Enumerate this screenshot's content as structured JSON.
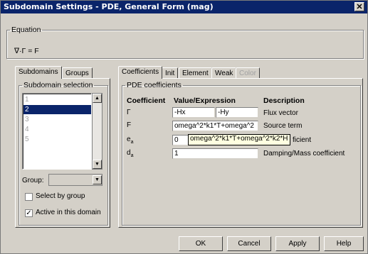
{
  "window": {
    "title": "Subdomain Settings - PDE, General Form (mag)",
    "close": "✕"
  },
  "equation": {
    "legend": "Equation",
    "text": "∇·Γ = F"
  },
  "left_tabs": [
    "Subdomains",
    "Groups"
  ],
  "subdomain_selection": {
    "legend": "Subdomain selection",
    "items": [
      "1",
      "2",
      "3",
      "4",
      "5"
    ],
    "selected_index": 1
  },
  "group": {
    "label": "Group:",
    "value": ""
  },
  "select_by_group": {
    "label": "Select by group",
    "checked": false
  },
  "active_in_domain": {
    "label": "Active in this domain",
    "checked": true
  },
  "right_tabs": [
    "Coefficients",
    "Init",
    "Element",
    "Weak",
    "Color"
  ],
  "pde": {
    "legend": "PDE coefficients",
    "headers": {
      "coefficient": "Coefficient",
      "value": "Value/Expression",
      "description": "Description"
    },
    "rows": [
      {
        "coef": "Γ",
        "value1": "-Hx",
        "value2": "-Hy",
        "desc": "Flux vector"
      },
      {
        "coef": "F",
        "value1": "omega^2*k1*T+omega^2",
        "desc": "Source term"
      },
      {
        "coef": "e",
        "sub": "a",
        "value1": "0",
        "desc": "ficient"
      },
      {
        "coef": "d",
        "sub": "a",
        "value1": "1",
        "desc": "Damping/Mass coefficient"
      }
    ],
    "tooltip": "omega^2*k1*T+omega^2*k2*H"
  },
  "buttons": {
    "ok": "OK",
    "cancel": "Cancel",
    "apply": "Apply",
    "help": "Help"
  }
}
